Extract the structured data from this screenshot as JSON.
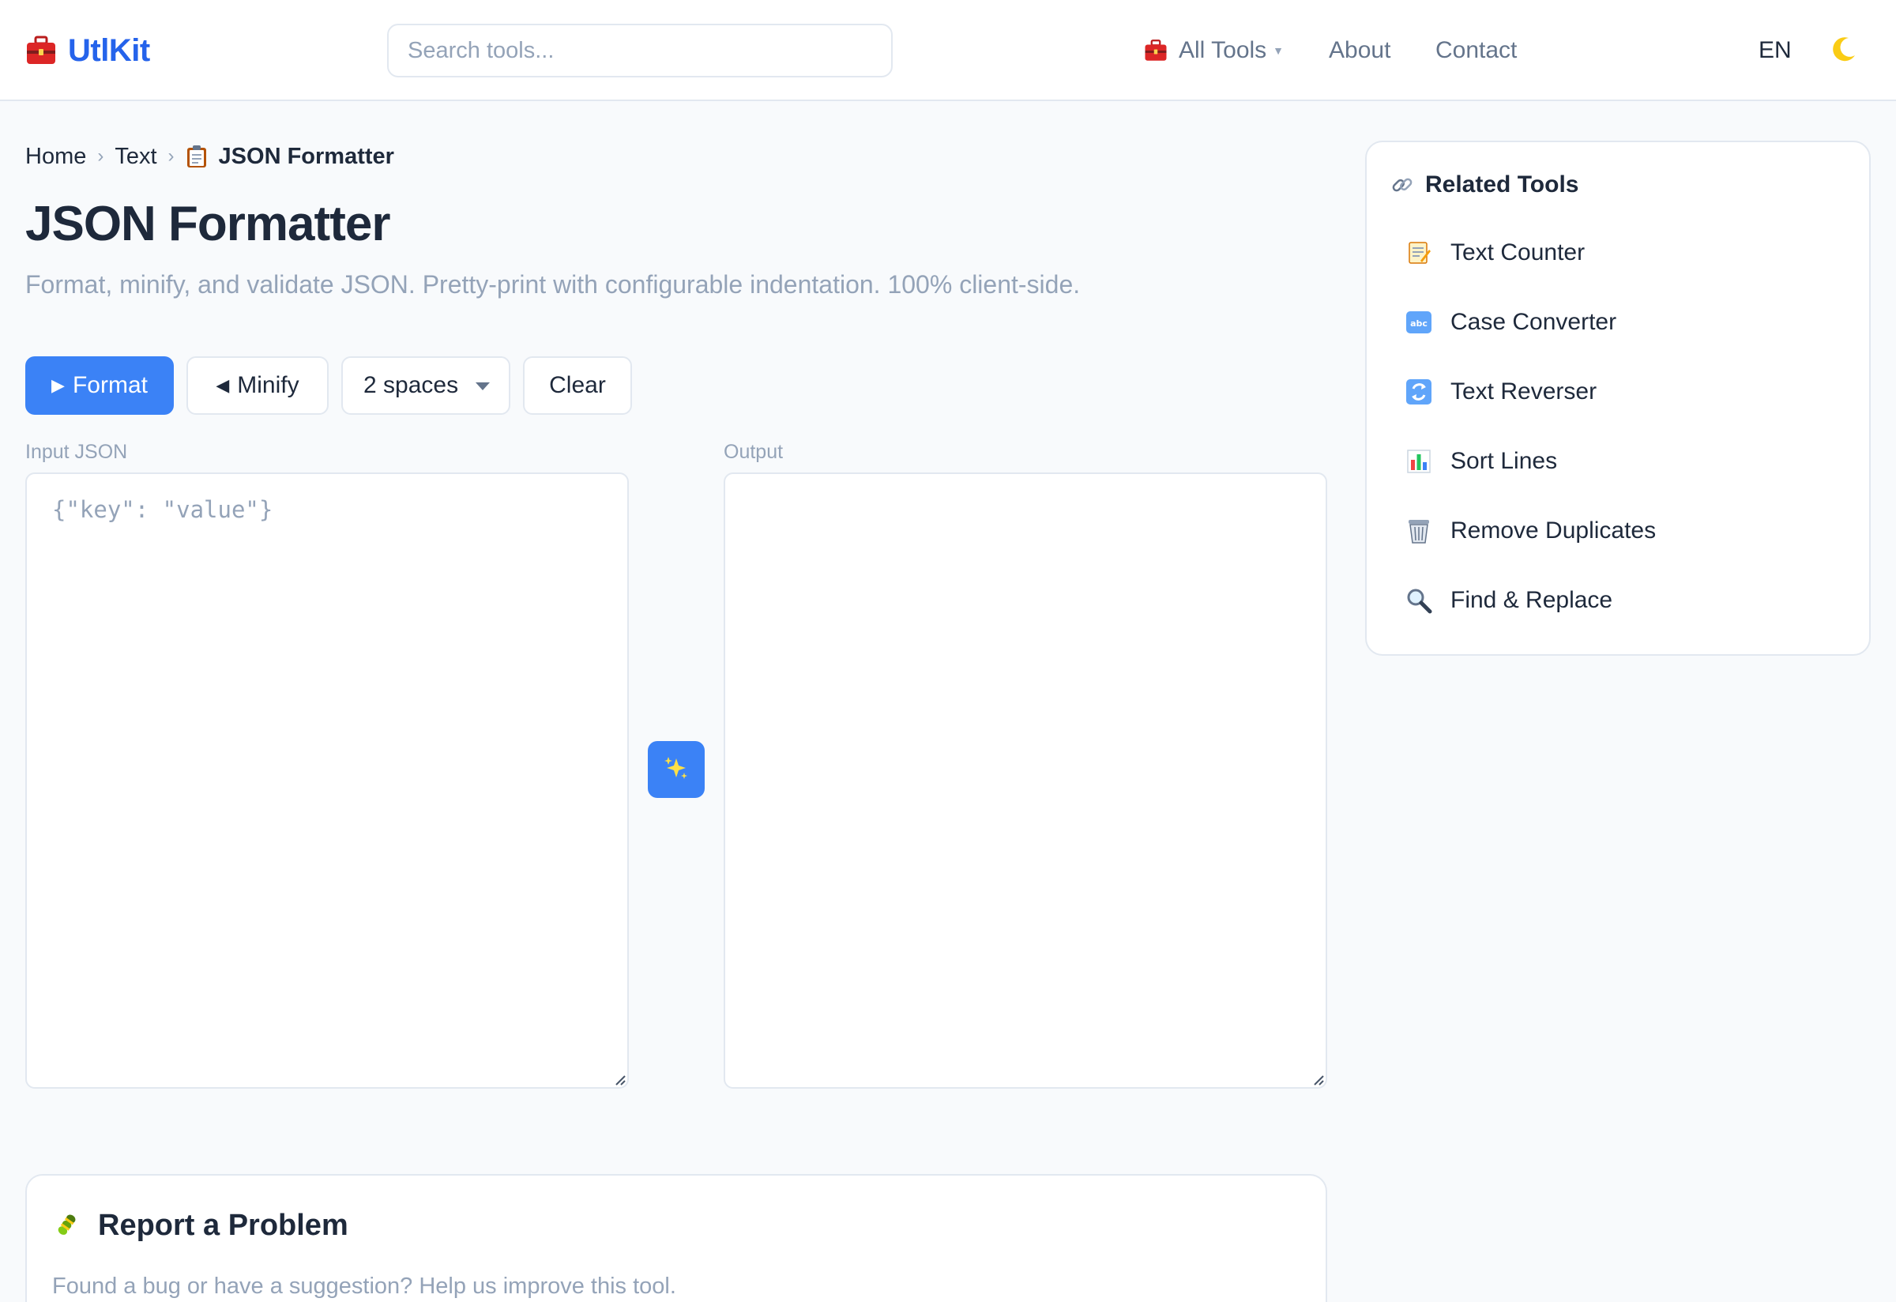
{
  "app": {
    "name": "UtlKit"
  },
  "header": {
    "search_placeholder": "Search tools...",
    "nav": {
      "all_tools": "All Tools",
      "about": "About",
      "contact": "Contact"
    },
    "language": "EN",
    "theme_icon": "moon-icon"
  },
  "breadcrumb": {
    "home": "Home",
    "category": "Text",
    "current": "JSON Formatter",
    "current_icon": "clipboard-icon"
  },
  "page": {
    "title": "JSON Formatter",
    "subtitle": "Format, minify, and validate JSON. Pretty-print with configurable indentation. 100% client-side."
  },
  "toolbar": {
    "format_label": "Format",
    "minify_label": "Minify",
    "indent_selected": "2 spaces",
    "clear_label": "Clear"
  },
  "editor": {
    "input_label": "Input JSON",
    "input_placeholder": "{\"key\": \"value\"}",
    "input_value": "",
    "output_label": "Output",
    "output_value": ""
  },
  "related": {
    "title": "Related Tools",
    "title_icon": "link-icon",
    "items": [
      {
        "label": "Text Counter",
        "icon": "memo-icon"
      },
      {
        "label": "Case Converter",
        "icon": "abc-icon"
      },
      {
        "label": "Text Reverser",
        "icon": "arrows-icon"
      },
      {
        "label": "Sort Lines",
        "icon": "bar-chart-icon"
      },
      {
        "label": "Remove Duplicates",
        "icon": "trash-icon"
      },
      {
        "label": "Find & Replace",
        "icon": "magnifier-icon"
      }
    ]
  },
  "report": {
    "title": "Report a Problem",
    "icon": "bug-icon",
    "text": "Found a bug or have a suggestion? Help us improve this tool."
  },
  "colors": {
    "brand": "#2563eb",
    "primary_button": "#3b82f6",
    "muted_text": "#94a3b8",
    "border": "#e2e8f0"
  }
}
